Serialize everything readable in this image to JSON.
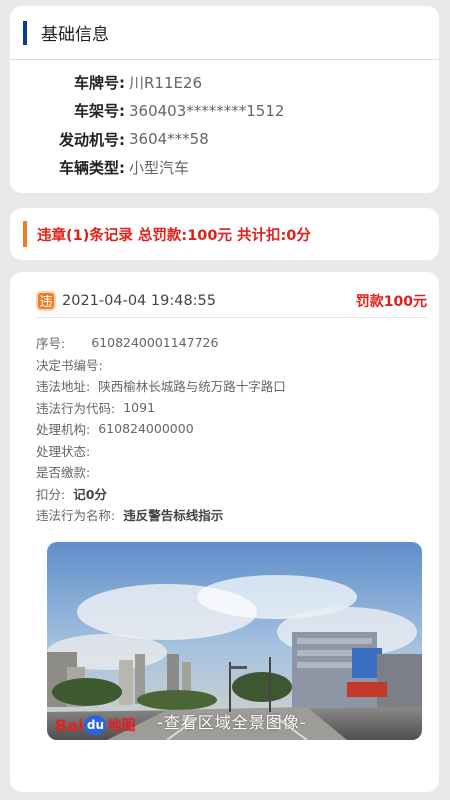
{
  "basic_info": {
    "title": "基础信息",
    "rows": [
      {
        "label": "车牌号:",
        "value": "川R11E26"
      },
      {
        "label": "车架号:",
        "value": "360403********1512"
      },
      {
        "label": "发动机号:",
        "value": "3604***58"
      },
      {
        "label": "车辆类型:",
        "value": "小型汽车"
      }
    ]
  },
  "summary": {
    "text": "违章(1)条记录  总罚款:100元  共计扣:0分"
  },
  "record": {
    "icon_char": "违",
    "datetime": "2021-04-04 19:48:55",
    "fine": "罚款100元",
    "details": {
      "seq_label": "序号:",
      "seq_value": "6108240001147726",
      "decision_label": "决定书编号:",
      "decision_value": "",
      "address_label": "违法地址:",
      "address_value": "陕西榆林长城路与统万路十字路口",
      "code_label": "违法行为代码:",
      "code_value": "1091",
      "agency_label": "处理机构:",
      "agency_value": "610824000000",
      "status_label": "处理状态:",
      "status_value": "",
      "paid_label": "是否缴款:",
      "paid_value": "",
      "points_label": "扣分:",
      "points_value": "记0分",
      "name_label": "违法行为名称:",
      "name_value": "违反警告标线指示"
    },
    "panorama": {
      "caption": "-查看区域全景图像-",
      "logo_bai": "Bai",
      "logo_du": "du",
      "logo_map": "地图"
    }
  },
  "colors": {
    "accent_blue": "#0d3a8a",
    "accent_orange": "#f07c2a",
    "alert_red": "#e0201a"
  }
}
